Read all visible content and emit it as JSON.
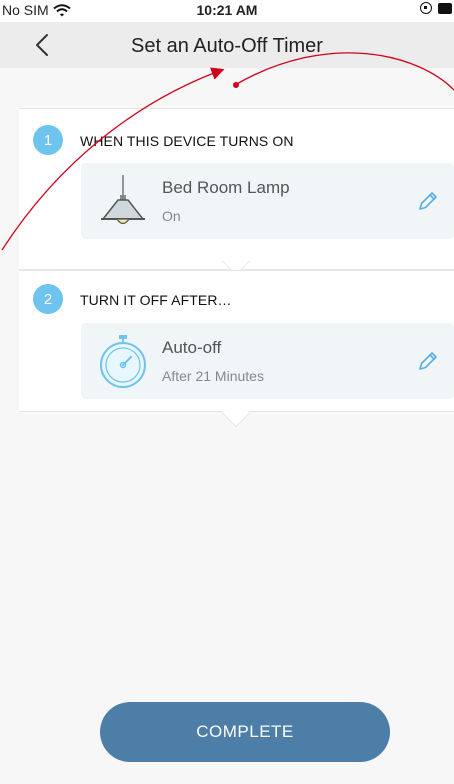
{
  "status_bar": {
    "carrier": "No SIM",
    "time": "10:21 AM",
    "icons": [
      "wifi-icon",
      "rotation-lock-icon",
      "battery-icon"
    ]
  },
  "nav": {
    "back_icon": "chevron-left-icon",
    "title": "Set an Auto-Off Timer"
  },
  "steps": [
    {
      "number": "1",
      "label": "WHEN THIS DEVICE TURNS ON",
      "item": {
        "icon": "pendant-lamp-icon",
        "title": "Bed Room Lamp",
        "subtitle": "On",
        "edit_icon": "pencil-icon"
      }
    },
    {
      "number": "2",
      "label": "TURN IT OFF AFTER…",
      "item": {
        "icon": "stopwatch-icon",
        "title": "Auto-off",
        "subtitle": "After 21 Minutes",
        "edit_icon": "pencil-icon"
      }
    }
  ],
  "footer": {
    "complete_label": "COMPLETE"
  },
  "colors": {
    "accent": "#6ec3ef",
    "button": "#4d7ea8",
    "nav_bg": "#ececec",
    "annotation": "#d0021b"
  }
}
